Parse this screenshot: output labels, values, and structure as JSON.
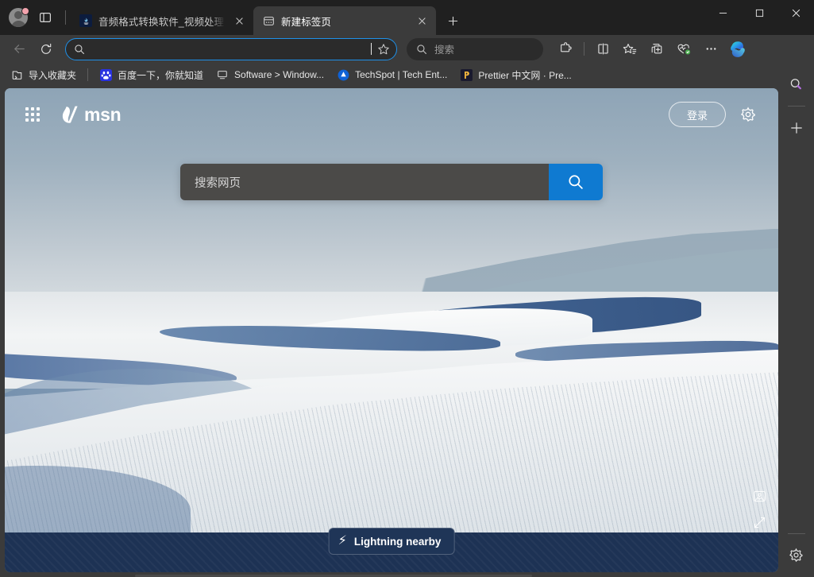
{
  "window": {
    "controls": {
      "minimize": "minimize-button",
      "maximize": "maximize-button",
      "close": "close-button"
    }
  },
  "tabstrip": {
    "profile_label": "profile-avatar",
    "tab_actions_label": "tab-actions-menu",
    "new_tab_label": "新建标签页",
    "tabs": [
      {
        "title": "音频格式转换软件_视频处理软件_",
        "favicon": "audio-converter-icon",
        "active": false,
        "close_label": "×"
      },
      {
        "title": "新建标签页",
        "favicon": "new-tab-page-icon",
        "active": true,
        "close_label": "×"
      }
    ],
    "plus_label": "+"
  },
  "toolbar": {
    "back_label": "back-button",
    "refresh_label": "refresh-button",
    "address": {
      "value": "",
      "placeholder": "",
      "search_icon": "search-icon",
      "favorite_icon": "star-icon"
    },
    "bing_search": {
      "placeholder": "搜索",
      "icon": "search-icon"
    },
    "actions": [
      {
        "name": "extensions-icon",
        "label": "扩展"
      },
      {
        "name": "split-screen-icon",
        "label": "拆分屏幕"
      },
      {
        "name": "favorites-icon",
        "label": "收藏夹"
      },
      {
        "name": "collections-icon",
        "label": "集锦"
      },
      {
        "name": "browser-essentials-icon",
        "label": "浏览器基本信息"
      },
      {
        "name": "settings-more-icon",
        "label": "设置及其他"
      },
      {
        "name": "copilot-icon",
        "label": "Copilot"
      }
    ]
  },
  "bookmarks_bar": {
    "import_label": "导入收藏夹",
    "items": [
      {
        "label": "百度一下，你就知道",
        "icon": "baidu-icon"
      },
      {
        "label": "Software > Window...",
        "icon": "software-icon"
      },
      {
        "label": "TechSpot | Tech Ent...",
        "icon": "techspot-icon"
      },
      {
        "label": "Prettier 中文网 · Pre...",
        "icon": "prettier-icon"
      }
    ]
  },
  "page": {
    "waffle_label": "app-launcher",
    "brand": "msn",
    "signin_label": "登录",
    "settings_label": "personalize-settings",
    "search": {
      "placeholder": "搜索网页",
      "button_label": "search-button"
    },
    "lightning_pill": {
      "label": "Lightning nearby",
      "icon": "⚡"
    },
    "corner_tools": [
      {
        "name": "image-info-icon"
      },
      {
        "name": "fullscreen-icon"
      }
    ]
  },
  "sidebar": {
    "items": [
      {
        "name": "sidebar-search-icon",
        "label": "搜索"
      },
      {
        "name": "sidebar-add-icon",
        "label": "+"
      },
      {
        "name": "sidebar-settings-icon",
        "label": "设置"
      }
    ]
  },
  "colors": {
    "chrome": "#3b3b3b",
    "titlebar": "#202020",
    "accent_blue": "#1e90e8",
    "msn_search_btn": "#0f7ad1",
    "feed_navy": "#1d3254",
    "badge_pink": "#f2a3ad"
  }
}
